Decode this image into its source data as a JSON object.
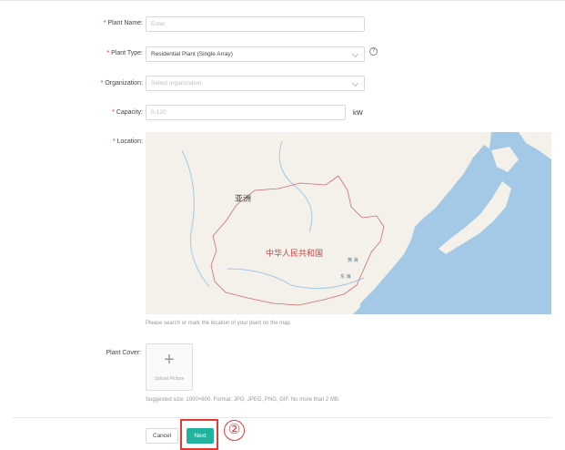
{
  "form": {
    "plant_name": {
      "label": "Plant Name:",
      "required_mark": "*",
      "placeholder": "Enter"
    },
    "plant_type": {
      "label": "Plant Type:",
      "required_mark": "*",
      "value": "Residential Plant (Single Array)",
      "help_glyph": "?"
    },
    "organization": {
      "label": "Organization:",
      "required_mark": "*",
      "placeholder": "Select organization"
    },
    "capacity": {
      "label": "Capacity:",
      "required_mark": "*",
      "placeholder": "0-120",
      "unit": "kW"
    },
    "location": {
      "label": "Location:",
      "required_mark": "*",
      "hint": "Please search or mark the location of your plant on the map.",
      "map_labels": {
        "continent": "亚洲",
        "country": "中华人民共和国",
        "sea1": "黄 海",
        "sea2": "东 海"
      }
    },
    "plant_cover": {
      "label": "Plant Cover:",
      "upload_plus": "+",
      "upload_label": "Upload Picture",
      "hint": "Suggested size: 1000×600. Format: JPG, JPEG, PNG, GIF. No more than 2 MB."
    }
  },
  "footer": {
    "cancel_label": "Cancel",
    "next_label": "Next",
    "step_marker": "②"
  },
  "colors": {
    "primary": "#22b3a0",
    "required": "#f5222d",
    "annotation": "#e53935",
    "water": "#a3c9e6",
    "land": "#f3f1ea"
  }
}
